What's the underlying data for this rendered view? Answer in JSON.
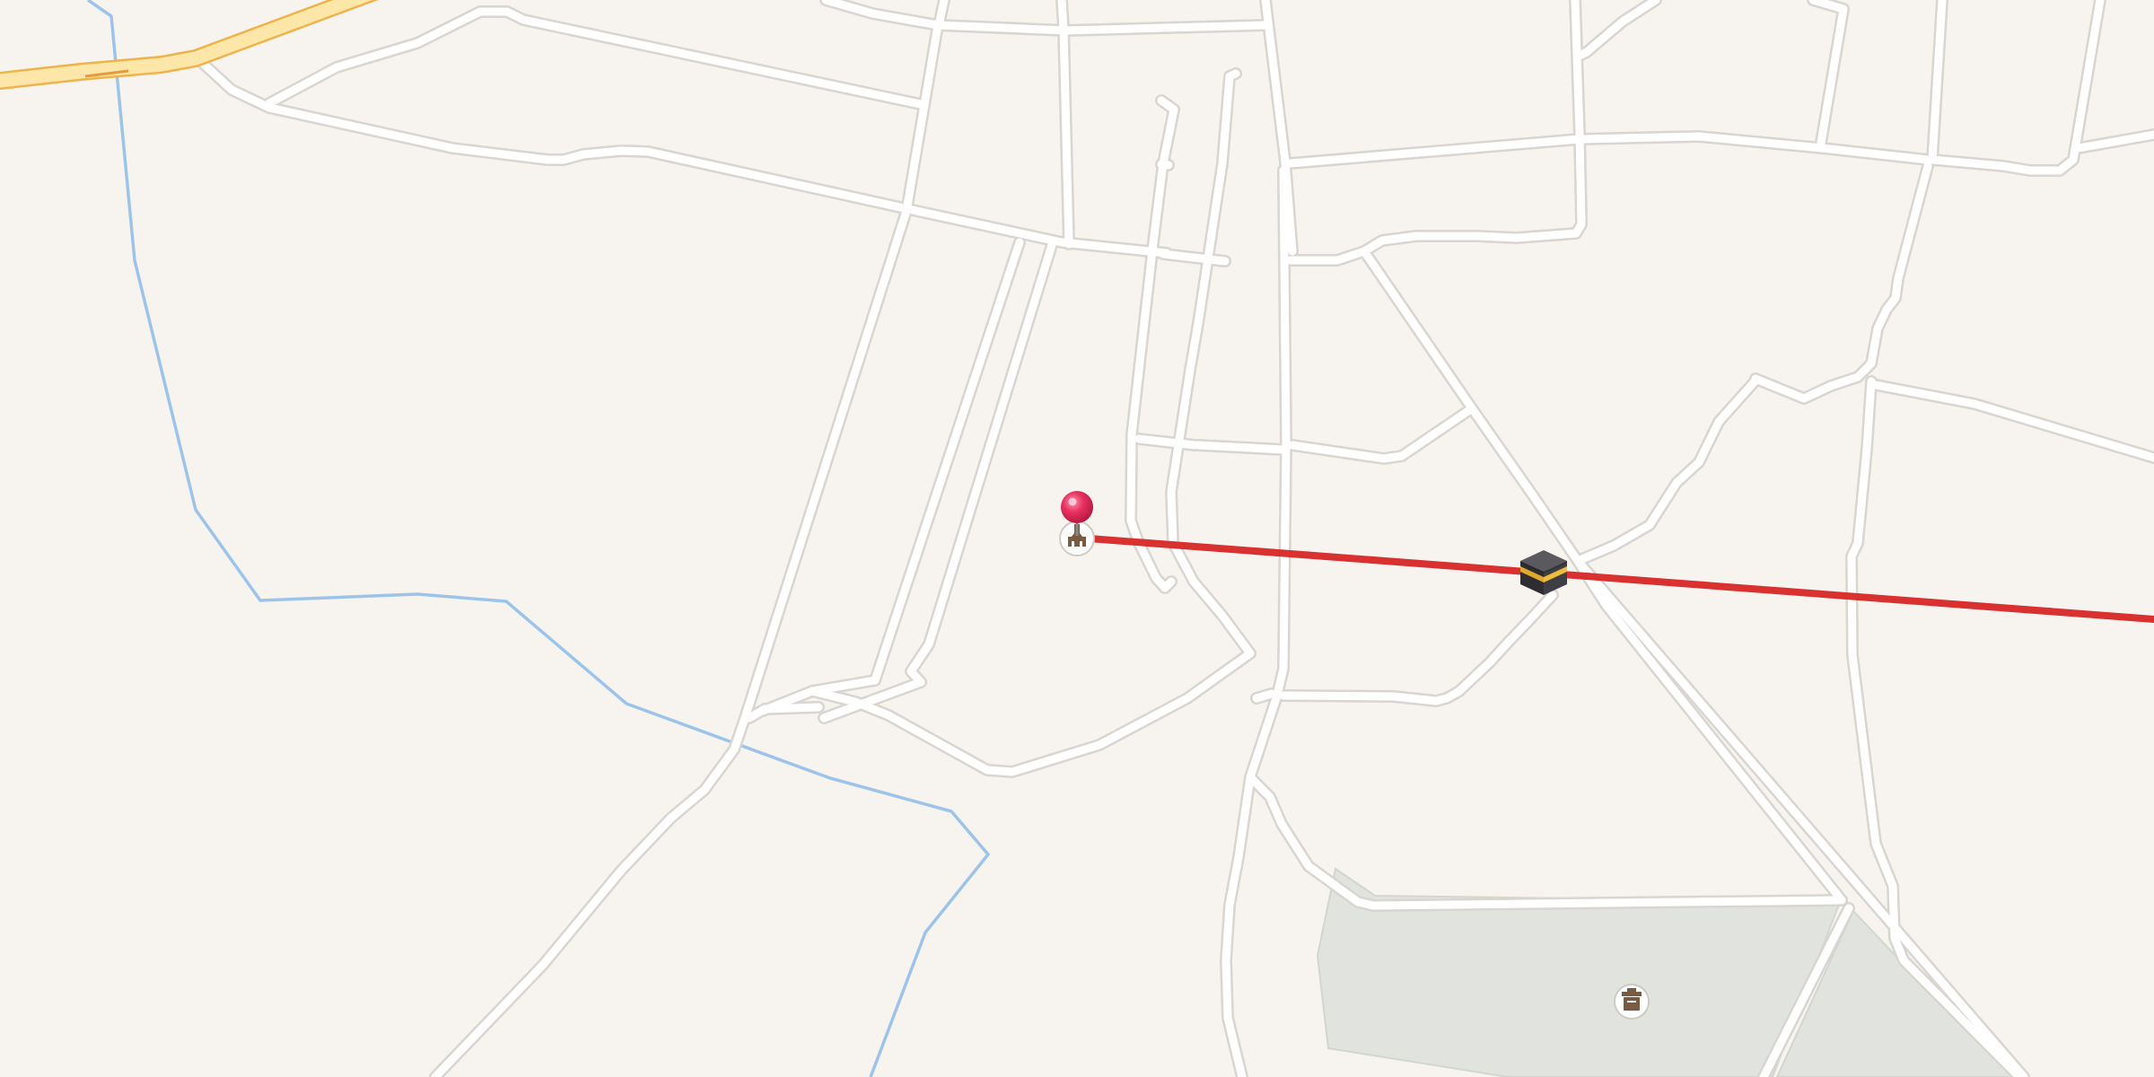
{
  "map": {
    "background_color": "#f7f4f0",
    "road_color": "#ffffff",
    "road_casing_color": "#d9d5d0",
    "highway_color": "#fde7a8",
    "highway_casing_color": "#f0b24a",
    "boundary_color": "#9cc4ea",
    "park_color": "#e1e4de"
  },
  "qibla_line": {
    "color": "#d93030"
  },
  "markers": {
    "location_pin": {
      "icon": "red-pin-icon",
      "color": "#e8315f"
    },
    "kaaba": {
      "icon": "kaaba-icon"
    },
    "poi_mosque": {
      "icon": "mosque-icon"
    },
    "poi_cemetery": {
      "icon": "cemetery-icon"
    }
  }
}
